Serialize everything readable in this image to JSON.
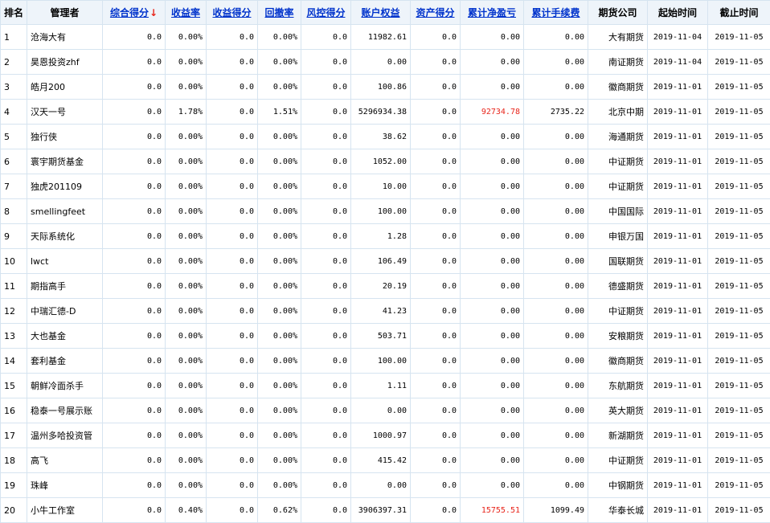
{
  "headers": {
    "rank": "排名",
    "manager": "管理者",
    "composite_score": "综合得分",
    "sort_arrow": "↓",
    "return_rate": "收益率",
    "return_score": "收益得分",
    "drawdown_rate": "回撤率",
    "risk_score": "风控得分",
    "account_equity": "账户权益",
    "asset_score": "资产得分",
    "cumulative_net_pnl": "累计净盈亏",
    "cumulative_fees": "累计手续费",
    "futures_company": "期货公司",
    "start_time": "起始时间",
    "end_time": "截止时间"
  },
  "colors": {
    "link": "#0033cc",
    "positive_pnl": "#e8251b",
    "border": "#d6e4f0",
    "header_bg": "#eef4fa"
  },
  "rows": [
    {
      "rank": "1",
      "manager": "沧海大有",
      "composite_score": "0.0",
      "return_rate": "0.00%",
      "return_score": "0.0",
      "drawdown_rate": "0.00%",
      "risk_score": "0.0",
      "account_equity": "11982.61",
      "asset_score": "0.0",
      "cumulative_net_pnl": "0.00",
      "cumulative_fees": "0.00",
      "futures_company": "大有期货",
      "start_time": "2019-11-04",
      "end_time": "2019-11-05"
    },
    {
      "rank": "2",
      "manager": "昊恩投资zhf",
      "composite_score": "0.0",
      "return_rate": "0.00%",
      "return_score": "0.0",
      "drawdown_rate": "0.00%",
      "risk_score": "0.0",
      "account_equity": "0.00",
      "asset_score": "0.0",
      "cumulative_net_pnl": "0.00",
      "cumulative_fees": "0.00",
      "futures_company": "南证期货",
      "start_time": "2019-11-04",
      "end_time": "2019-11-05"
    },
    {
      "rank": "3",
      "manager": "皓月200",
      "composite_score": "0.0",
      "return_rate": "0.00%",
      "return_score": "0.0",
      "drawdown_rate": "0.00%",
      "risk_score": "0.0",
      "account_equity": "100.86",
      "asset_score": "0.0",
      "cumulative_net_pnl": "0.00",
      "cumulative_fees": "0.00",
      "futures_company": "徽商期货",
      "start_time": "2019-11-01",
      "end_time": "2019-11-05"
    },
    {
      "rank": "4",
      "manager": "汉天一号",
      "composite_score": "0.0",
      "return_rate": "1.78%",
      "return_score": "0.0",
      "drawdown_rate": "1.51%",
      "risk_score": "0.0",
      "account_equity": "5296934.38",
      "asset_score": "0.0",
      "cumulative_net_pnl": "92734.78",
      "cumulative_fees": "2735.22",
      "futures_company": "北京中期",
      "start_time": "2019-11-01",
      "end_time": "2019-11-05",
      "pnl_red": true
    },
    {
      "rank": "5",
      "manager": "独行侠",
      "composite_score": "0.0",
      "return_rate": "0.00%",
      "return_score": "0.0",
      "drawdown_rate": "0.00%",
      "risk_score": "0.0",
      "account_equity": "38.62",
      "asset_score": "0.0",
      "cumulative_net_pnl": "0.00",
      "cumulative_fees": "0.00",
      "futures_company": "海通期货",
      "start_time": "2019-11-01",
      "end_time": "2019-11-05"
    },
    {
      "rank": "6",
      "manager": "寰宇期货基金",
      "composite_score": "0.0",
      "return_rate": "0.00%",
      "return_score": "0.0",
      "drawdown_rate": "0.00%",
      "risk_score": "0.0",
      "account_equity": "1052.00",
      "asset_score": "0.0",
      "cumulative_net_pnl": "0.00",
      "cumulative_fees": "0.00",
      "futures_company": "中证期货",
      "start_time": "2019-11-01",
      "end_time": "2019-11-05"
    },
    {
      "rank": "7",
      "manager": "独虎201109",
      "composite_score": "0.0",
      "return_rate": "0.00%",
      "return_score": "0.0",
      "drawdown_rate": "0.00%",
      "risk_score": "0.0",
      "account_equity": "10.00",
      "asset_score": "0.0",
      "cumulative_net_pnl": "0.00",
      "cumulative_fees": "0.00",
      "futures_company": "中证期货",
      "start_time": "2019-11-01",
      "end_time": "2019-11-05"
    },
    {
      "rank": "8",
      "manager": "smellingfeet",
      "composite_score": "0.0",
      "return_rate": "0.00%",
      "return_score": "0.0",
      "drawdown_rate": "0.00%",
      "risk_score": "0.0",
      "account_equity": "100.00",
      "asset_score": "0.0",
      "cumulative_net_pnl": "0.00",
      "cumulative_fees": "0.00",
      "futures_company": "中国国际",
      "start_time": "2019-11-01",
      "end_time": "2019-11-05"
    },
    {
      "rank": "9",
      "manager": "天际系统化",
      "composite_score": "0.0",
      "return_rate": "0.00%",
      "return_score": "0.0",
      "drawdown_rate": "0.00%",
      "risk_score": "0.0",
      "account_equity": "1.28",
      "asset_score": "0.0",
      "cumulative_net_pnl": "0.00",
      "cumulative_fees": "0.00",
      "futures_company": "申银万国",
      "start_time": "2019-11-01",
      "end_time": "2019-11-05"
    },
    {
      "rank": "10",
      "manager": "lwct",
      "composite_score": "0.0",
      "return_rate": "0.00%",
      "return_score": "0.0",
      "drawdown_rate": "0.00%",
      "risk_score": "0.0",
      "account_equity": "106.49",
      "asset_score": "0.0",
      "cumulative_net_pnl": "0.00",
      "cumulative_fees": "0.00",
      "futures_company": "国联期货",
      "start_time": "2019-11-01",
      "end_time": "2019-11-05"
    },
    {
      "rank": "11",
      "manager": "期指高手",
      "composite_score": "0.0",
      "return_rate": "0.00%",
      "return_score": "0.0",
      "drawdown_rate": "0.00%",
      "risk_score": "0.0",
      "account_equity": "20.19",
      "asset_score": "0.0",
      "cumulative_net_pnl": "0.00",
      "cumulative_fees": "0.00",
      "futures_company": "德盛期货",
      "start_time": "2019-11-01",
      "end_time": "2019-11-05"
    },
    {
      "rank": "12",
      "manager": "中瑞汇德-D",
      "composite_score": "0.0",
      "return_rate": "0.00%",
      "return_score": "0.0",
      "drawdown_rate": "0.00%",
      "risk_score": "0.0",
      "account_equity": "41.23",
      "asset_score": "0.0",
      "cumulative_net_pnl": "0.00",
      "cumulative_fees": "0.00",
      "futures_company": "中证期货",
      "start_time": "2019-11-01",
      "end_time": "2019-11-05"
    },
    {
      "rank": "13",
      "manager": "大也基金",
      "composite_score": "0.0",
      "return_rate": "0.00%",
      "return_score": "0.0",
      "drawdown_rate": "0.00%",
      "risk_score": "0.0",
      "account_equity": "503.71",
      "asset_score": "0.0",
      "cumulative_net_pnl": "0.00",
      "cumulative_fees": "0.00",
      "futures_company": "安粮期货",
      "start_time": "2019-11-01",
      "end_time": "2019-11-05"
    },
    {
      "rank": "14",
      "manager": "套利基金",
      "composite_score": "0.0",
      "return_rate": "0.00%",
      "return_score": "0.0",
      "drawdown_rate": "0.00%",
      "risk_score": "0.0",
      "account_equity": "100.00",
      "asset_score": "0.0",
      "cumulative_net_pnl": "0.00",
      "cumulative_fees": "0.00",
      "futures_company": "徽商期货",
      "start_time": "2019-11-01",
      "end_time": "2019-11-05"
    },
    {
      "rank": "15",
      "manager": "朝鲜冷面杀手",
      "composite_score": "0.0",
      "return_rate": "0.00%",
      "return_score": "0.0",
      "drawdown_rate": "0.00%",
      "risk_score": "0.0",
      "account_equity": "1.11",
      "asset_score": "0.0",
      "cumulative_net_pnl": "0.00",
      "cumulative_fees": "0.00",
      "futures_company": "东航期货",
      "start_time": "2019-11-01",
      "end_time": "2019-11-05"
    },
    {
      "rank": "16",
      "manager": "稳泰一号展示账",
      "composite_score": "0.0",
      "return_rate": "0.00%",
      "return_score": "0.0",
      "drawdown_rate": "0.00%",
      "risk_score": "0.0",
      "account_equity": "0.00",
      "asset_score": "0.0",
      "cumulative_net_pnl": "0.00",
      "cumulative_fees": "0.00",
      "futures_company": "英大期货",
      "start_time": "2019-11-01",
      "end_time": "2019-11-05"
    },
    {
      "rank": "17",
      "manager": "温州多哈投资管",
      "composite_score": "0.0",
      "return_rate": "0.00%",
      "return_score": "0.0",
      "drawdown_rate": "0.00%",
      "risk_score": "0.0",
      "account_equity": "1000.97",
      "asset_score": "0.0",
      "cumulative_net_pnl": "0.00",
      "cumulative_fees": "0.00",
      "futures_company": "新湖期货",
      "start_time": "2019-11-01",
      "end_time": "2019-11-05"
    },
    {
      "rank": "18",
      "manager": "高飞",
      "composite_score": "0.0",
      "return_rate": "0.00%",
      "return_score": "0.0",
      "drawdown_rate": "0.00%",
      "risk_score": "0.0",
      "account_equity": "415.42",
      "asset_score": "0.0",
      "cumulative_net_pnl": "0.00",
      "cumulative_fees": "0.00",
      "futures_company": "中证期货",
      "start_time": "2019-11-01",
      "end_time": "2019-11-05"
    },
    {
      "rank": "19",
      "manager": "珠峰",
      "composite_score": "0.0",
      "return_rate": "0.00%",
      "return_score": "0.0",
      "drawdown_rate": "0.00%",
      "risk_score": "0.0",
      "account_equity": "0.00",
      "asset_score": "0.0",
      "cumulative_net_pnl": "0.00",
      "cumulative_fees": "0.00",
      "futures_company": "中钢期货",
      "start_time": "2019-11-01",
      "end_time": "2019-11-05"
    },
    {
      "rank": "20",
      "manager": "小牛工作室",
      "composite_score": "0.0",
      "return_rate": "0.40%",
      "return_score": "0.0",
      "drawdown_rate": "0.62%",
      "risk_score": "0.0",
      "account_equity": "3906397.31",
      "asset_score": "0.0",
      "cumulative_net_pnl": "15755.51",
      "cumulative_fees": "1099.49",
      "futures_company": "华泰长城",
      "start_time": "2019-11-01",
      "end_time": "2019-11-05",
      "pnl_red": true
    }
  ]
}
